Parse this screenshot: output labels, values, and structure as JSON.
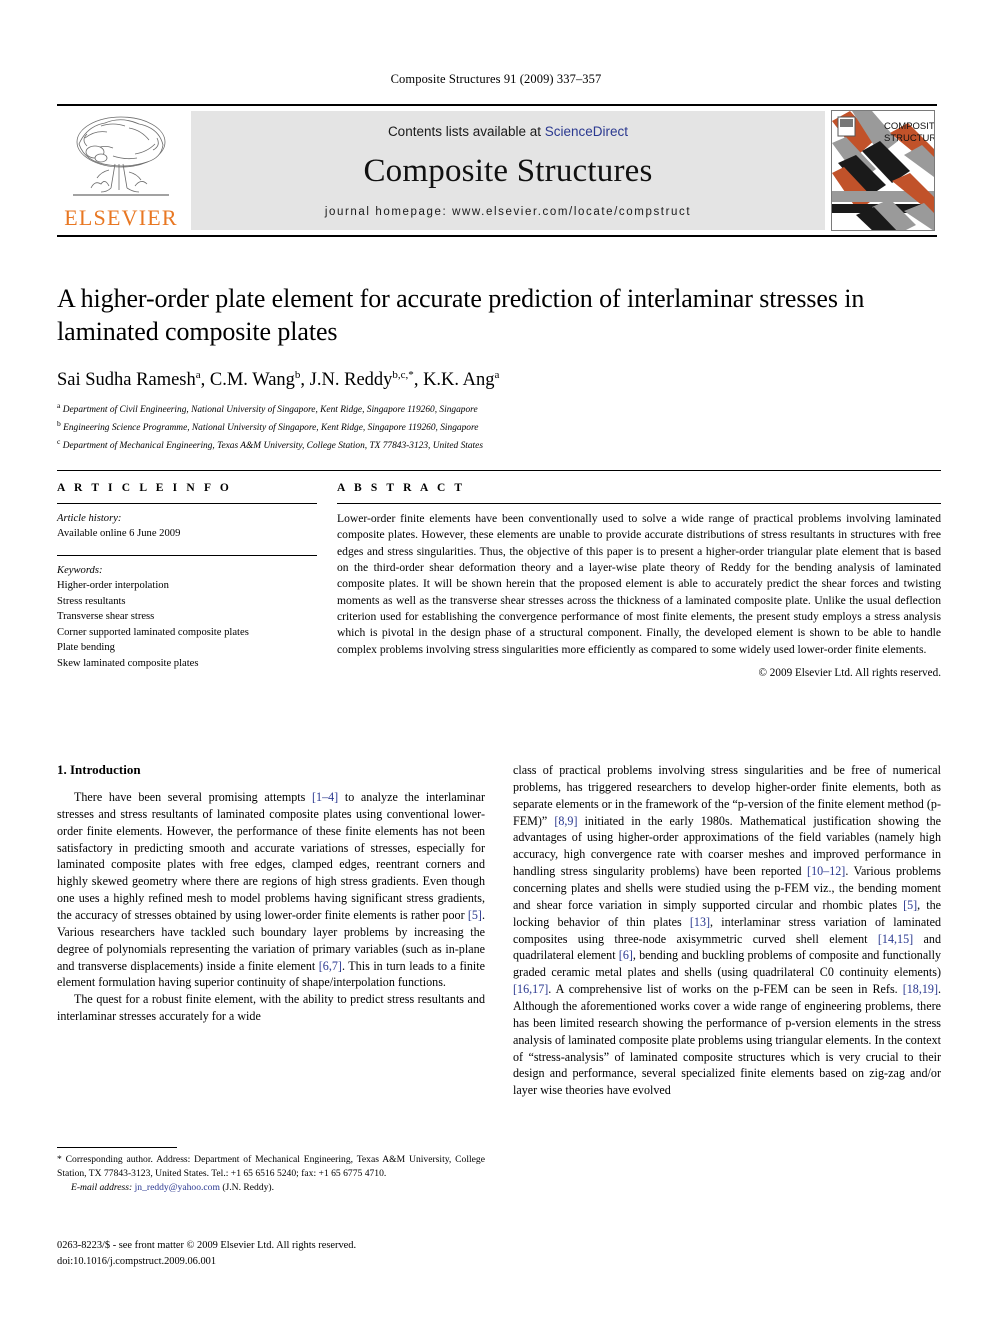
{
  "running_head": "Composite Structures 91 (2009) 337–357",
  "masthead": {
    "publisher_name": "ELSEVIER",
    "contents_prefix": "Contents lists available at ",
    "contents_link": "ScienceDirect",
    "journal_title": "Composite Structures",
    "homepage": "journal homepage: www.elsevier.com/locate/compstruct",
    "cover_title_line1": "COMPOSITE",
    "cover_title_line2": "STRUCTURES",
    "colors": {
      "elsevier_orange": "#E87722",
      "link_blue": "#2b3990",
      "band_gray": "#e4e4e4",
      "cover_orange": "#C1522A",
      "cover_gray": "#9a9a9a"
    }
  },
  "article": {
    "title": "A higher-order plate element for accurate prediction of interlaminar stresses in laminated composite plates",
    "authors": "Sai Sudha Ramesh a, C.M. Wang b, J.N. Reddy b,c,*, K.K. Ang a",
    "affiliations": [
      "a Department of Civil Engineering, National University of Singapore, Kent Ridge, Singapore 119260, Singapore",
      "b Engineering Science Programme, National University of Singapore, Kent Ridge, Singapore 119260, Singapore",
      "c Department of Mechanical Engineering, Texas A&M University, College Station, TX 77843-3123, United States"
    ]
  },
  "article_info": {
    "heading": "A R T I C L E  I N F O",
    "history_label": "Article history:",
    "history_value": "Available online 6 June 2009",
    "keywords_label": "Keywords:",
    "keywords": [
      "Higher-order interpolation",
      "Stress resultants",
      "Transverse shear stress",
      "Corner supported laminated composite plates",
      "Plate bending",
      "Skew laminated composite plates"
    ]
  },
  "abstract": {
    "heading": "A B S T R A C T",
    "text": "Lower-order finite elements have been conventionally used to solve a wide range of practical problems involving laminated composite plates. However, these elements are unable to provide accurate distributions of stress resultants in structures with free edges and stress singularities. Thus, the objective of this paper is to present a higher-order triangular plate element that is based on the third-order shear deformation theory and a layer-wise plate theory of Reddy for the bending analysis of laminated composite plates. It will be shown herein that the proposed element is able to accurately predict the shear forces and twisting moments as well as the transverse shear stresses across the thickness of a laminated composite plate. Unlike the usual deflection criterion used for establishing the convergence performance of most finite elements, the present study employs a stress analysis which is pivotal in the design phase of a structural component. Finally, the developed element is shown to be able to handle complex problems involving stress singularities more efficiently as compared to some widely used lower-order finite elements.",
    "copyright": "© 2009 Elsevier Ltd. All rights reserved."
  },
  "introduction": {
    "heading": "1. Introduction",
    "left_para_1_a": "There have been several promising attempts ",
    "left_para_1_ref1": "[1–4]",
    "left_para_1_b": " to analyze the interlaminar stresses and stress resultants of laminated composite plates using conventional lower-order finite elements. However, the performance of these finite elements has not been satisfactory in predicting smooth and accurate variations of stresses, especially for laminated composite plates with free edges, clamped edges, reentrant corners and highly skewed geometry where there are regions of high stress gradients. Even though one uses a highly refined mesh to model problems having significant stress gradients, the accuracy of stresses obtained by using lower-order finite elements is rather poor ",
    "left_para_1_ref2": "[5]",
    "left_para_1_c": ". Various researchers have tackled such boundary layer problems by increasing the degree of polynomials representing the variation of primary variables (such as in-plane and transverse displacements) inside a finite element ",
    "left_para_1_ref3": "[6,7]",
    "left_para_1_d": ". This in turn leads to a finite element formulation having superior continuity of shape/interpolation functions.",
    "left_para_2": "The quest for a robust finite element, with the ability to predict stress resultants and interlaminar stresses accurately for a wide",
    "right_para_a": "class of practical problems involving stress singularities and be free of numerical problems, has triggered researchers to develop higher-order finite elements, both as separate elements or in the framework of the “p-version of the finite element method (p-FEM)” ",
    "right_ref1": "[8,9]",
    "right_para_b": " initiated in the early 1980s. Mathematical justification showing the advantages of using higher-order approximations of the field variables (namely high accuracy, high convergence rate with coarser meshes and improved performance in handling stress singularity problems) have been reported ",
    "right_ref2": "[10–12]",
    "right_para_c": ". Various problems concerning plates and shells were studied using the p-FEM viz., the bending moment and shear force variation in simply supported circular and rhombic plates ",
    "right_ref3": "[5]",
    "right_para_d": ", the locking behavior of thin plates ",
    "right_ref4": "[13]",
    "right_para_e": ", interlaminar stress variation of laminated composites using three-node axisymmetric curved shell element ",
    "right_ref5": "[14,15]",
    "right_para_f": " and quadrilateral element ",
    "right_ref6": "[6]",
    "right_para_g": ", bending and buckling problems of composite and functionally graded ceramic metal plates and shells (using quadrilateral C0 continuity elements) ",
    "right_ref7": "[16,17]",
    "right_para_h": ". A comprehensive list of works on the p-FEM can be seen in Refs. ",
    "right_ref8": "[18,19]",
    "right_para_i": ". Although the aforementioned works cover a wide range of engineering problems, there has been limited research showing the performance of p-version elements in the stress analysis of laminated composite plate problems using triangular elements. In the context of “stress-analysis” of laminated composite structures which is very crucial to their design and performance, several specialized finite elements based on zig-zag and/or layer wise theories have evolved"
  },
  "footnotes": {
    "corresponding": "* Corresponding author. Address: Department of Mechanical Engineering, Texas A&M University, College Station, TX 77843-3123, United States. Tel.: +1 65 6516 5240; fax: +1 65 6775 4710.",
    "email_label": "E-mail address:",
    "email": "jn_reddy@yahoo.com",
    "email_owner": "(J.N. Reddy).",
    "imprint_line1": "0263-8223/$ - see front matter © 2009 Elsevier Ltd. All rights reserved.",
    "imprint_line2": "doi:10.1016/j.compstruct.2009.06.001"
  }
}
